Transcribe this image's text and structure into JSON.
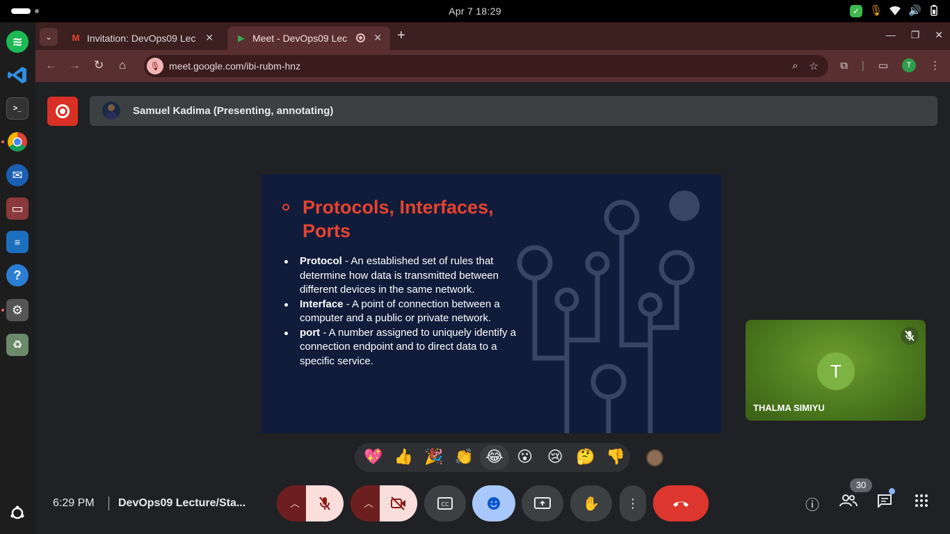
{
  "system": {
    "clock": "Apr 7  18:29",
    "tray_icons": [
      "shield-check-icon",
      "mic-icon",
      "wifi-icon",
      "volume-icon",
      "battery-icon"
    ]
  },
  "dock": {
    "apps": [
      "Spotify",
      "Visual Studio Code",
      "Terminal",
      "Google Chrome",
      "Thunderbird",
      "Files",
      "LibreOffice Writer",
      "Help",
      "Settings",
      "Trash"
    ]
  },
  "browser": {
    "tabs": [
      {
        "title": "Invitation: DevOps09 Lec",
        "favicon": "M"
      },
      {
        "title": "Meet - DevOps09 Lec",
        "favicon": "▶"
      }
    ],
    "url": "meet.google.com/ibi-rubm-hnz",
    "profile_initial": "T"
  },
  "meet": {
    "presenter_label": "Samuel Kadima (Presenting, annotating)",
    "slide": {
      "title": "Protocols, Interfaces, Ports",
      "bullets": [
        {
          "term": "Protocol",
          "text": " - An established set of rules that determine how data is transmitted between different devices in the same network."
        },
        {
          "term": "Interface",
          "text": " - A point of connection between a computer and a public or private network."
        },
        {
          "term": "port",
          "text": " - A number assigned to uniquely identify a connection endpoint and to direct data to a specific service."
        }
      ]
    },
    "participant": {
      "initial": "T",
      "name": "THALMA SIMIYU"
    },
    "reactions": [
      "💖",
      "👍",
      "🎉",
      "👏",
      "😂",
      "😮",
      "😢",
      "🤔",
      "👎"
    ],
    "time": "6:29 PM",
    "meeting_name": "DevOps09 Lecture/Sta...",
    "participant_count": "30"
  }
}
